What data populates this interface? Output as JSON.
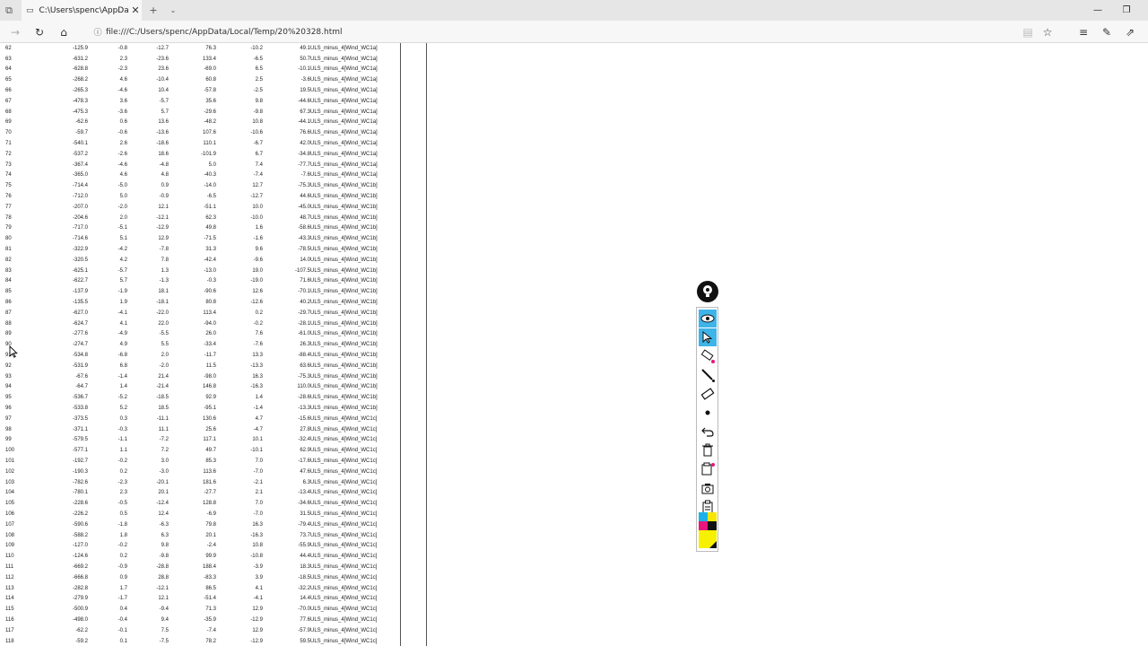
{
  "browser": {
    "tab_title": "C:\\Users\\spenc\\AppDat",
    "url": "file:///C:/Users/spenc/AppData/Local/Temp/20%20328.html",
    "icons": [
      "back-icon",
      "refresh-icon",
      "home-icon",
      "info-icon",
      "reading-view-icon",
      "favorite-star-icon",
      "hub-icon",
      "notes-pen-icon",
      "share-icon"
    ]
  },
  "table": {
    "rows": [
      [
        "62",
        "-125.9",
        "-0.8",
        "-12.7",
        "76.3",
        "-10.2",
        "49.1",
        "ULS_minus_4[Wind_WC1a]"
      ],
      [
        "63",
        "-631.2",
        "2.3",
        "-23.6",
        "133.4",
        "-6.5",
        "50.7",
        "ULS_minus_4[Wind_WC1a]"
      ],
      [
        "64",
        "-628.8",
        "-2.3",
        "23.6",
        "-69.0",
        "6.5",
        "-10.1",
        "ULS_minus_4[Wind_WC1a]"
      ],
      [
        "65",
        "-268.2",
        "4.6",
        "-10.4",
        "60.8",
        "2.5",
        "-3.6",
        "ULS_minus_4[Wind_WC1a]"
      ],
      [
        "66",
        "-265.3",
        "-4.6",
        "10.4",
        "-57.8",
        "-2.5",
        "19.5",
        "ULS_minus_4[Wind_WC1a]"
      ],
      [
        "67",
        "-478.3",
        "3.6",
        "-5.7",
        "35.6",
        "9.8",
        "-44.6",
        "ULS_minus_4[Wind_WC1a]"
      ],
      [
        "68",
        "-475.3",
        "-3.6",
        "5.7",
        "-29.6",
        "-9.8",
        "67.3",
        "ULS_minus_4[Wind_WC1a]"
      ],
      [
        "69",
        "-62.6",
        "0.6",
        "13.6",
        "-48.2",
        "10.8",
        "-44.1",
        "ULS_minus_4[Wind_WC1a]"
      ],
      [
        "70",
        "-59.7",
        "-0.6",
        "-13.6",
        "107.6",
        "-10.6",
        "76.6",
        "ULS_minus_4[Wind_WC1a]"
      ],
      [
        "71",
        "-540.1",
        "2.6",
        "-18.6",
        "110.1",
        "-6.7",
        "42.0",
        "ULS_minus_4[Wind_WC1a]"
      ],
      [
        "72",
        "-537.2",
        "-2.6",
        "18.6",
        "-101.9",
        "6.7",
        "-34.8",
        "ULS_minus_4[Wind_WC1a]"
      ],
      [
        "73",
        "-367.4",
        "-4.6",
        "-4.8",
        "5.0",
        "7.4",
        "-77.7",
        "ULS_minus_4[Wind_WC1a]"
      ],
      [
        "74",
        "-365.0",
        "4.6",
        "4.8",
        "-40.3",
        "-7.4",
        "-7.6",
        "ULS_minus_4[Wind_WC1a]"
      ],
      [
        "75",
        "-714.4",
        "-5.0",
        "0.9",
        "-14.0",
        "12.7",
        "-75.3",
        "ULS_minus_4[Wind_WC1b]"
      ],
      [
        "76",
        "-712.0",
        "5.0",
        "-0.9",
        "-6.5",
        "-12.7",
        "44.6",
        "ULS_minus_4[Wind_WC1b]"
      ],
      [
        "77",
        "-207.0",
        "-2.0",
        "12.1",
        "-51.1",
        "10.0",
        "-45.0",
        "ULS_minus_4[Wind_WC1b]"
      ],
      [
        "78",
        "-204.6",
        "2.0",
        "-12.1",
        "62.3",
        "-10.0",
        "48.7",
        "ULS_minus_4[Wind_WC1b]"
      ],
      [
        "79",
        "-717.0",
        "-5.1",
        "-12.9",
        "49.8",
        "1.6",
        "-58.6",
        "ULS_minus_4[Wind_WC1b]"
      ],
      [
        "80",
        "-714.6",
        "5.1",
        "12.9",
        "-71.5",
        "-1.6",
        "-43.3",
        "ULS_minus_4[Wind_WC1b]"
      ],
      [
        "81",
        "-322.9",
        "-4.2",
        "-7.8",
        "31.3",
        "9.6",
        "-78.5",
        "ULS_minus_4[Wind_WC1b]"
      ],
      [
        "82",
        "-320.5",
        "4.2",
        "7.8",
        "-42.4",
        "-9.6",
        "14.0",
        "ULS_minus_4[Wind_WC1b]"
      ],
      [
        "83",
        "-625.1",
        "-5.7",
        "1.3",
        "-13.0",
        "19.0",
        "-107.5",
        "ULS_minus_4[Wind_WC1b]"
      ],
      [
        "84",
        "-622.7",
        "5.7",
        "-1.3",
        "-0.3",
        "-19.0",
        "71.6",
        "ULS_minus_4[Wind_WC1b]"
      ],
      [
        "85",
        "-137.9",
        "-1.9",
        "18.1",
        "-90.6",
        "12.6",
        "-70.1",
        "ULS_minus_4[Wind_WC1b]"
      ],
      [
        "86",
        "-135.5",
        "1.9",
        "-18.1",
        "80.8",
        "-12.6",
        "40.2",
        "ULS_minus_4[Wind_WC1b]"
      ],
      [
        "87",
        "-627.0",
        "-4.1",
        "-22.0",
        "113.4",
        "0.2",
        "-29.7",
        "ULS_minus_4[Wind_WC1b]"
      ],
      [
        "88",
        "-624.7",
        "4.1",
        "22.0",
        "-94.0",
        "-0.2",
        "-28.1",
        "ULS_minus_4[Wind_WC1b]"
      ],
      [
        "89",
        "-277.6",
        "-4.9",
        "-5.5",
        "26.0",
        "7.6",
        "-61.0",
        "ULS_minus_4[Wind_WC1b]"
      ],
      [
        "90",
        "-274.7",
        "4.9",
        "5.5",
        "-33.4",
        "-7.6",
        "26.3",
        "ULS_minus_4[Wind_WC1b]"
      ],
      [
        "91",
        "-534.8",
        "-6.8",
        "2.0",
        "-11.7",
        "13.3",
        "-88.4",
        "ULS_minus_4[Wind_WC1b]"
      ],
      [
        "92",
        "-531.9",
        "6.8",
        "-2.0",
        "11.5",
        "-13.3",
        "63.6",
        "ULS_minus_4[Wind_WC1b]"
      ],
      [
        "93",
        "-67.6",
        "-1.4",
        "21.4",
        "-98.0",
        "16.3",
        "-75.3",
        "ULS_minus_4[Wind_WC1b]"
      ],
      [
        "94",
        "-64.7",
        "1.4",
        "-21.4",
        "146.8",
        "-16.3",
        "110.0",
        "ULS_minus_4[Wind_WC1b]"
      ],
      [
        "95",
        "-536.7",
        "-5.2",
        "-18.5",
        "92.9",
        "1.4",
        "-28.6",
        "ULS_minus_4[Wind_WC1b]"
      ],
      [
        "96",
        "-533.8",
        "5.2",
        "18.5",
        "-95.1",
        "-1.4",
        "-13.3",
        "ULS_minus_4[Wind_WC1b]"
      ],
      [
        "97",
        "-373.5",
        "0.3",
        "-11.1",
        "130.6",
        "4.7",
        "-15.6",
        "ULS_minus_4[Wind_WC1c]"
      ],
      [
        "98",
        "-371.1",
        "-0.3",
        "11.1",
        "25.6",
        "-4.7",
        "27.8",
        "ULS_minus_4[Wind_WC1c]"
      ],
      [
        "99",
        "-579.5",
        "-1.1",
        "-7.2",
        "117.1",
        "10.1",
        "-32.4",
        "ULS_minus_4[Wind_WC1c]"
      ],
      [
        "100",
        "-577.1",
        "1.1",
        "7.2",
        "49.7",
        "-10.1",
        "62.9",
        "ULS_minus_4[Wind_WC1c]"
      ],
      [
        "101",
        "-192.7",
        "-0.2",
        "3.0",
        "85.3",
        "7.0",
        "-17.6",
        "ULS_minus_4[Wind_WC1c]"
      ],
      [
        "102",
        "-190.3",
        "0.2",
        "-3.0",
        "113.6",
        "-7.0",
        "47.6",
        "ULS_minus_4[Wind_WC1c]"
      ],
      [
        "103",
        "-782.6",
        "-2.3",
        "-20.1",
        "181.6",
        "-2.1",
        "6.3",
        "ULS_minus_4[Wind_WC1c]"
      ],
      [
        "104",
        "-780.1",
        "2.3",
        "20.1",
        "-27.7",
        "2.1",
        "-13.4",
        "ULS_minus_4[Wind_WC1c]"
      ],
      [
        "105",
        "-228.6",
        "-0.5",
        "-12.4",
        "128.8",
        "7.0",
        "-34.6",
        "ULS_minus_4[Wind_WC1c]"
      ],
      [
        "106",
        "-226.2",
        "0.5",
        "12.4",
        "-6.9",
        "-7.0",
        "31.5",
        "ULS_minus_4[Wind_WC1c]"
      ],
      [
        "107",
        "-590.6",
        "-1.8",
        "-6.3",
        "79.8",
        "16.3",
        "-79.4",
        "ULS_minus_4[Wind_WC1c]"
      ],
      [
        "108",
        "-588.2",
        "1.8",
        "6.3",
        "20.1",
        "-16.3",
        "73.7",
        "ULS_minus_4[Wind_WC1c]"
      ],
      [
        "109",
        "-127.0",
        "-0.2",
        "9.8",
        "-2.4",
        "10.8",
        "-55.9",
        "ULS_minus_4[Wind_WC1c]"
      ],
      [
        "110",
        "-124.6",
        "0.2",
        "-9.8",
        "99.9",
        "-10.8",
        "44.4",
        "ULS_minus_4[Wind_WC1c]"
      ],
      [
        "111",
        "-669.2",
        "-0.9",
        "-28.8",
        "188.4",
        "-3.9",
        "18.3",
        "ULS_minus_4[Wind_WC1c]"
      ],
      [
        "112",
        "-666.8",
        "0.9",
        "28.8",
        "-83.3",
        "3.9",
        "-18.5",
        "ULS_minus_4[Wind_WC1c]"
      ],
      [
        "113",
        "-282.8",
        "1.7",
        "-12.1",
        "86.5",
        "4.1",
        "-32.2",
        "ULS_minus_4[Wind_WC1c]"
      ],
      [
        "114",
        "-279.9",
        "-1.7",
        "12.1",
        "-51.4",
        "-4.1",
        "14.4",
        "ULS_minus_4[Wind_WC1c]"
      ],
      [
        "115",
        "-500.9",
        "0.4",
        "-9.4",
        "71.3",
        "12.9",
        "-70.0",
        "ULS_minus_4[Wind_WC1c]"
      ],
      [
        "116",
        "-498.0",
        "-0.4",
        "9.4",
        "-35.9",
        "-12.9",
        "77.6",
        "ULS_minus_4[Wind_WC1c]"
      ],
      [
        "117",
        "-62.2",
        "-0.1",
        "7.5",
        "-7.4",
        "12.9",
        "-57.9",
        "ULS_minus_4[Wind_WC1c]"
      ],
      [
        "118",
        "-59.2",
        "0.1",
        "-7.5",
        "78.2",
        "-12.9",
        "59.5",
        "ULS_minus_4[Wind_WC1c]"
      ]
    ]
  },
  "pen_palette": {
    "tools": [
      "lightbulb-logo-icon",
      "eye-icon",
      "pointer-arrow-icon",
      "marker-icon",
      "pen-icon",
      "eraser-icon",
      "dot-icon",
      "undo-icon",
      "trash-icon",
      "clipboard-copy-icon",
      "camera-icon",
      "clipboard-icon"
    ],
    "colors": [
      "#1ab2e8",
      "#f7e600",
      "#e8157d",
      "#111111",
      "#f7f000"
    ]
  }
}
